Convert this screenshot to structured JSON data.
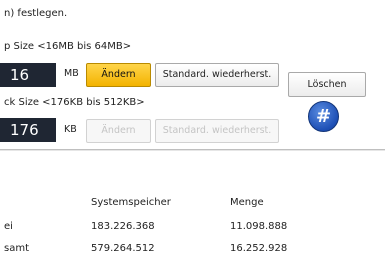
{
  "header": {
    "text": "n) festlegen."
  },
  "setting1": {
    "label": "p Size <16MB bis 64MB>",
    "value": "16",
    "unit": "MB",
    "change_label": "Ändern",
    "reset_label": "Standard. wiederherst."
  },
  "setting2": {
    "label": "ck Size <176KB bis 512KB>",
    "value": "176",
    "unit": "KB",
    "change_label": "Ändern",
    "reset_label": "Standard. wiederherst."
  },
  "delete_label": "Löschen",
  "hash_label": "#",
  "table": {
    "headers": [
      "Systemspeicher",
      "Menge"
    ],
    "rows": [
      {
        "label": "ei",
        "systemspeicher": "183.226.368",
        "menge": "11.098.888"
      },
      {
        "label": "samt",
        "systemspeicher": "579.264.512",
        "menge": "16.252.928"
      }
    ]
  },
  "colors": {
    "active_button": "#f3b300",
    "value_box": "#1f2633",
    "hash_button": "#1d4fb5"
  }
}
